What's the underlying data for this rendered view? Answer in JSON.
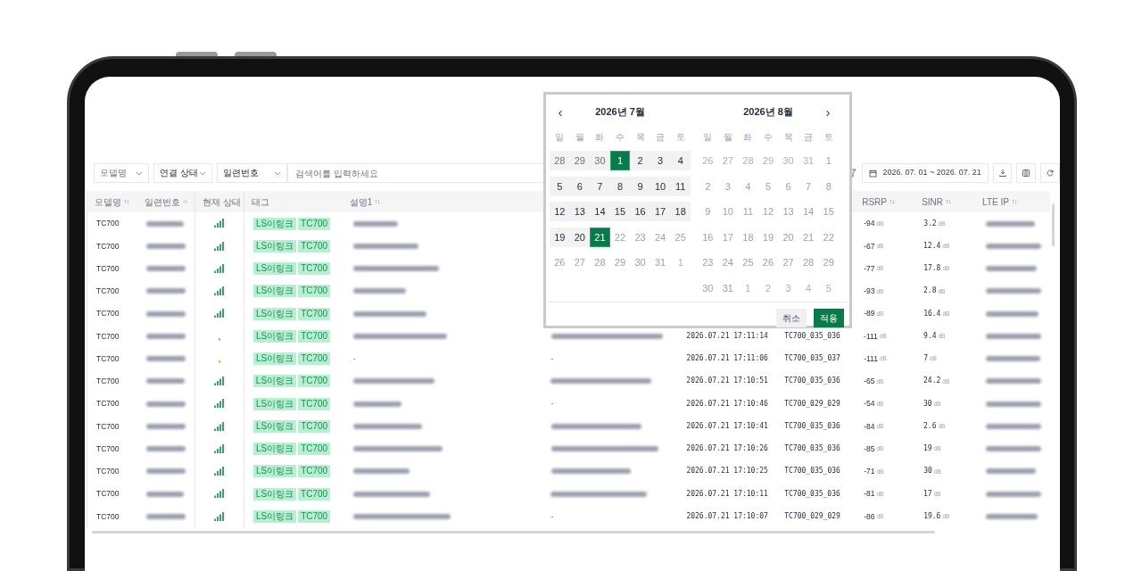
{
  "toolbar": {
    "filters": [
      {
        "placeholder": "모델명"
      },
      {
        "value": "연결 상태"
      },
      {
        "value": "일련번호"
      }
    ],
    "search": {
      "placeholder": "검색어를 입력하세요"
    },
    "date_range": {
      "value": "2026. 07. 01 ~ 2026. 07. 21"
    }
  },
  "table": {
    "columns": [
      {
        "label": "모델명",
        "sortable": true
      },
      {
        "label": "일련번호",
        "sortable": true
      },
      {
        "label": "현재 상태",
        "sortable": false
      },
      {
        "label": "태그",
        "sortable": false
      },
      {
        "label": "설명1",
        "sortable": true
      },
      {
        "label": "RSRP",
        "sortable": true
      },
      {
        "label": "SINR",
        "sortable": true
      },
      {
        "label": "LTE IP",
        "sortable": true
      }
    ],
    "rows": [
      {
        "model": "TC700",
        "color": "#3aa36c",
        "tags": [
          "LS이링크",
          "TC700"
        ],
        "rsrp": "-94",
        "rsrp_unit": "dB",
        "sinr": "3.2",
        "sinr_unit": "dB"
      },
      {
        "model": "TC700",
        "color": "#3aa36c",
        "tags": [
          "LS이링크",
          "TC700"
        ],
        "rsrp": "-67",
        "rsrp_unit": "dB",
        "sinr": "12.4",
        "sinr_unit": "dB"
      },
      {
        "model": "TC700",
        "color": "#3aa36c",
        "tags": [
          "LS이링크",
          "TC700"
        ],
        "rsrp": "-77",
        "rsrp_unit": "dB",
        "sinr": "17.8",
        "sinr_unit": "dB"
      },
      {
        "model": "TC700",
        "color": "#3aa36c",
        "tags": [
          "LS이링크",
          "TC700"
        ],
        "rsrp": "-93",
        "rsrp_unit": "dB",
        "sinr": "2.8",
        "sinr_unit": "dB"
      },
      {
        "model": "TC700",
        "color": "#3aa36c",
        "tags": [
          "LS이링크",
          "TC700"
        ],
        "rsrp": "-89",
        "rsrp_unit": "dB",
        "sinr": "16.4",
        "sinr_unit": "dB"
      },
      {
        "model": "TC700",
        "color": "#e0b21a",
        "tags": [
          "LS이링크",
          "TC700"
        ],
        "time": "2026.07.21 17:11:14",
        "device": "TC700_035_036",
        "rsrp": "-111",
        "rsrp_unit": "dB",
        "sinr": "9.4",
        "sinr_unit": "dB"
      },
      {
        "model": "TC700",
        "color": "#e0b21a",
        "tags": [
          "LS이링크",
          "TC700"
        ],
        "description": "-",
        "address": "-",
        "time": "2026.07.21 17:11:06",
        "device": "TC700_035_037",
        "rsrp": "-111",
        "rsrp_unit": "dB",
        "sinr": "7",
        "sinr_unit": "dB"
      },
      {
        "model": "TC700",
        "color": "#3aa36c",
        "tags": [
          "LS이링크",
          "TC700"
        ],
        "time": "2026.07.21 17:10:51",
        "device": "TC700_035_036",
        "rsrp": "-65",
        "rsrp_unit": "dB",
        "sinr": "24.2",
        "sinr_unit": "dB"
      },
      {
        "model": "TC700",
        "color": "#3aa36c",
        "tags": [
          "LS이링크",
          "TC700"
        ],
        "address": "-",
        "time": "2026.07.21 17:10:46",
        "device": "TC700_029_029",
        "rsrp": "-54",
        "rsrp_unit": "dB",
        "sinr": "30",
        "sinr_unit": "dB"
      },
      {
        "model": "TC700",
        "color": "#3aa36c",
        "tags": [
          "LS이링크",
          "TC700"
        ],
        "time": "2026.07.21 17:10:41",
        "device": "TC700_035_036",
        "rsrp": "-84",
        "rsrp_unit": "dB",
        "sinr": "2.6",
        "sinr_unit": "dB"
      },
      {
        "model": "TC700",
        "color": "#3aa36c",
        "tags": [
          "LS이링크",
          "TC700"
        ],
        "time": "2026.07.21 17:10:26",
        "device": "TC700_035_036",
        "rsrp": "-85",
        "rsrp_unit": "dB",
        "sinr": "19",
        "sinr_unit": "dB"
      },
      {
        "model": "TC700",
        "color": "#3aa36c",
        "tags": [
          "LS이링크",
          "TC700"
        ],
        "time": "2026.07.21 17:10:25",
        "device": "TC700_035_036",
        "rsrp": "-71",
        "rsrp_unit": "dB",
        "sinr": "30",
        "sinr_unit": "dB"
      },
      {
        "model": "TC700",
        "color": "#3aa36c",
        "tags": [
          "LS이링크",
          "TC700"
        ],
        "time": "2026.07.21 17:10:11",
        "device": "TC700_035_036",
        "rsrp": "-81",
        "rsrp_unit": "dB",
        "sinr": "17",
        "sinr_unit": "dB"
      },
      {
        "model": "TC700",
        "color": "#3aa36c",
        "tags": [
          "LS이링크",
          "TC700"
        ],
        "address": "-",
        "time": "2026.07.21 17:10:07",
        "device": "TC700_029_029",
        "rsrp": "-86",
        "rsrp_unit": "dB",
        "sinr": "19.6",
        "sinr_unit": "dB"
      }
    ]
  },
  "date_picker": {
    "prev": "‹",
    "next": "›",
    "months": [
      {
        "title": "2026년 7월",
        "weekdays": [
          "일",
          "월",
          "화",
          "수",
          "목",
          "금",
          "토"
        ],
        "days": [
          {
            "day": "28",
            "in_range": true,
            "selected": false,
            "other_month": true
          },
          {
            "day": "29",
            "in_range": true,
            "selected": false,
            "other_month": true
          },
          {
            "day": "30",
            "in_range": true,
            "selected": false,
            "other_month": true
          },
          {
            "day": "1",
            "in_range": true,
            "selected": true,
            "other_month": false
          },
          {
            "day": "2",
            "in_range": true,
            "selected": false,
            "other_month": false
          },
          {
            "day": "3",
            "in_range": true,
            "selected": false,
            "other_month": false
          },
          {
            "day": "4",
            "in_range": true,
            "selected": false,
            "other_month": false
          },
          {
            "day": "5",
            "in_range": true,
            "selected": false,
            "other_month": false
          },
          {
            "day": "6",
            "in_range": true,
            "selected": false,
            "other_month": false
          },
          {
            "day": "7",
            "in_range": true,
            "selected": false,
            "other_month": false
          },
          {
            "day": "8",
            "in_range": true,
            "selected": false,
            "other_month": false
          },
          {
            "day": "9",
            "in_range": true,
            "selected": false,
            "other_month": false
          },
          {
            "day": "10",
            "in_range": true,
            "selected": false,
            "other_month": false
          },
          {
            "day": "11",
            "in_range": true,
            "selected": false,
            "other_month": false
          },
          {
            "day": "12",
            "in_range": true,
            "selected": false,
            "other_month": false
          },
          {
            "day": "13",
            "in_range": true,
            "selected": false,
            "other_month": false
          },
          {
            "day": "14",
            "in_range": true,
            "selected": false,
            "other_month": false
          },
          {
            "day": "15",
            "in_range": true,
            "selected": false,
            "other_month": false
          },
          {
            "day": "16",
            "in_range": true,
            "selected": false,
            "other_month": false
          },
          {
            "day": "17",
            "in_range": true,
            "selected": false,
            "other_month": false
          },
          {
            "day": "18",
            "in_range": true,
            "selected": false,
            "other_month": false
          },
          {
            "day": "19",
            "in_range": true,
            "selected": false,
            "other_month": false
          },
          {
            "day": "20",
            "in_range": true,
            "selected": false,
            "other_month": false
          },
          {
            "day": "21",
            "in_range": true,
            "selected": true,
            "other_month": false
          },
          {
            "day": "22",
            "in_range": false,
            "selected": false,
            "other_month": false
          },
          {
            "day": "23",
            "in_range": false,
            "selected": false,
            "other_month": false
          },
          {
            "day": "24",
            "in_range": false,
            "selected": false,
            "other_month": false
          },
          {
            "day": "25",
            "in_range": false,
            "selected": false,
            "other_month": false
          },
          {
            "day": "26",
            "in_range": false,
            "selected": false,
            "other_month": false
          },
          {
            "day": "27",
            "in_range": false,
            "selected": false,
            "other_month": false
          },
          {
            "day": "28",
            "in_range": false,
            "selected": false,
            "other_month": false
          },
          {
            "day": "29",
            "in_range": false,
            "selected": false,
            "other_month": false
          },
          {
            "day": "30",
            "in_range": false,
            "selected": false,
            "other_month": false
          },
          {
            "day": "31",
            "in_range": false,
            "selected": false,
            "other_month": false
          },
          {
            "day": "1",
            "in_range": false,
            "selected": false,
            "other_month": true
          }
        ]
      },
      {
        "title": "2026년 8월",
        "weekdays": [
          "일",
          "월",
          "화",
          "수",
          "목",
          "금",
          "토"
        ],
        "days": [
          {
            "day": "26",
            "in_range": false,
            "selected": false,
            "other_month": true
          },
          {
            "day": "27",
            "in_range": false,
            "selected": false,
            "other_month": true
          },
          {
            "day": "28",
            "in_range": false,
            "selected": false,
            "other_month": true
          },
          {
            "day": "29",
            "in_range": false,
            "selected": false,
            "other_month": true
          },
          {
            "day": "30",
            "in_range": false,
            "selected": false,
            "other_month": true
          },
          {
            "day": "31",
            "in_range": false,
            "selected": false,
            "other_month": true
          },
          {
            "day": "1",
            "in_range": false,
            "selected": false,
            "other_month": false
          },
          {
            "day": "2",
            "in_range": false,
            "selected": false,
            "other_month": false
          },
          {
            "day": "3",
            "in_range": false,
            "selected": false,
            "other_month": false
          },
          {
            "day": "4",
            "in_range": false,
            "selected": false,
            "other_month": false
          },
          {
            "day": "5",
            "in_range": false,
            "selected": false,
            "other_month": false
          },
          {
            "day": "6",
            "in_range": false,
            "selected": false,
            "other_month": false
          },
          {
            "day": "7",
            "in_range": false,
            "selected": false,
            "other_month": false
          },
          {
            "day": "8",
            "in_range": false,
            "selected": false,
            "other_month": false
          },
          {
            "day": "9",
            "in_range": false,
            "selected": false,
            "other_month": false
          },
          {
            "day": "10",
            "in_range": false,
            "selected": false,
            "other_month": false
          },
          {
            "day": "11",
            "in_range": false,
            "selected": false,
            "other_month": false
          },
          {
            "day": "12",
            "in_range": false,
            "selected": false,
            "other_month": false
          },
          {
            "day": "13",
            "in_range": false,
            "selected": false,
            "other_month": false
          },
          {
            "day": "14",
            "in_range": false,
            "selected": false,
            "other_month": false
          },
          {
            "day": "15",
            "in_range": false,
            "selected": false,
            "other_month": false
          },
          {
            "day": "16",
            "in_range": false,
            "selected": false,
            "other_month": false
          },
          {
            "day": "17",
            "in_range": false,
            "selected": false,
            "other_month": false
          },
          {
            "day": "18",
            "in_range": false,
            "selected": false,
            "other_month": false
          },
          {
            "day": "19",
            "in_range": false,
            "selected": false,
            "other_month": false
          },
          {
            "day": "20",
            "in_range": false,
            "selected": false,
            "other_month": false
          },
          {
            "day": "21",
            "in_range": false,
            "selected": false,
            "other_month": false
          },
          {
            "day": "22",
            "in_range": false,
            "selected": false,
            "other_month": false
          },
          {
            "day": "23",
            "in_range": false,
            "selected": false,
            "other_month": false
          },
          {
            "day": "24",
            "in_range": false,
            "selected": false,
            "other_month": false
          },
          {
            "day": "25",
            "in_range": false,
            "selected": false,
            "other_month": false
          },
          {
            "day": "26",
            "in_range": false,
            "selected": false,
            "other_month": false
          },
          {
            "day": "27",
            "in_range": false,
            "selected": false,
            "other_month": false
          },
          {
            "day": "28",
            "in_range": false,
            "selected": false,
            "other_month": false
          },
          {
            "day": "29",
            "in_range": false,
            "selected": false,
            "other_month": false
          },
          {
            "day": "30",
            "in_range": false,
            "selected": false,
            "other_month": false
          },
          {
            "day": "31",
            "in_range": false,
            "selected": false,
            "other_month": false
          },
          {
            "day": "1",
            "in_range": false,
            "selected": false,
            "other_month": true
          },
          {
            "day": "2",
            "in_range": false,
            "selected": false,
            "other_month": true
          },
          {
            "day": "3",
            "in_range": false,
            "selected": false,
            "other_month": true
          },
          {
            "day": "4",
            "in_range": false,
            "selected": false,
            "other_month": true
          },
          {
            "day": "5",
            "in_range": false,
            "selected": false,
            "other_month": true
          }
        ]
      }
    ],
    "buttons": [
      {
        "label": "취소",
        "kind": "secondary"
      },
      {
        "label": "적용",
        "kind": "primary"
      }
    ]
  }
}
